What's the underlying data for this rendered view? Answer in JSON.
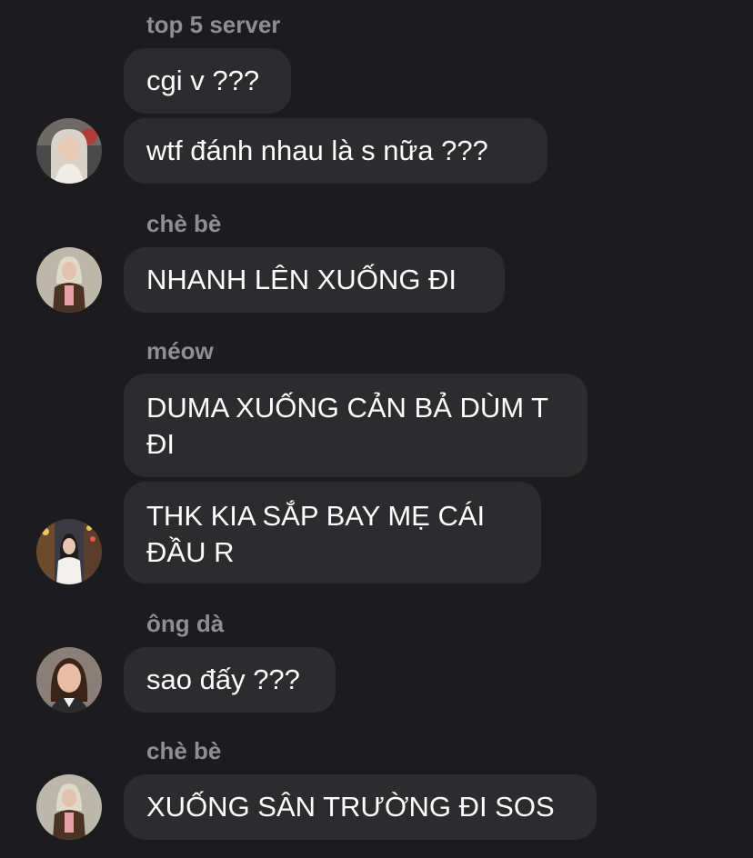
{
  "messages": [
    {
      "sender": "top 5 server",
      "text": "cgi v ???"
    },
    {
      "sender": "",
      "text": "wtf đánh nhau là s nữa ???",
      "avatar": "avatar-girl-light-hair-icon"
    },
    {
      "sender": "chè bè",
      "text": "NHANH LÊN XUỐNG ĐI",
      "avatar": "avatar-girl-jacket-icon"
    },
    {
      "sender": "méow",
      "text": "DUMA XUỐNG CẢN BẢ DÙM T ĐI"
    },
    {
      "sender": "",
      "text": "THK KIA SẮP BAY MẸ CÁI ĐẦU R",
      "avatar": "avatar-girl-street-icon"
    },
    {
      "sender": "ông dà",
      "text": "sao đấy ???",
      "avatar": "avatar-woman-portrait-icon"
    },
    {
      "sender": "chè bè",
      "text": "XUỐNG SÂN TRƯỜNG ĐI SOS",
      "avatar": "avatar-girl-jacket-icon"
    }
  ],
  "colors": {
    "background": "#1c1c1e",
    "bubble": "#2c2c2e",
    "sender_name": "#8e8e93",
    "message_text": "#ffffff"
  }
}
